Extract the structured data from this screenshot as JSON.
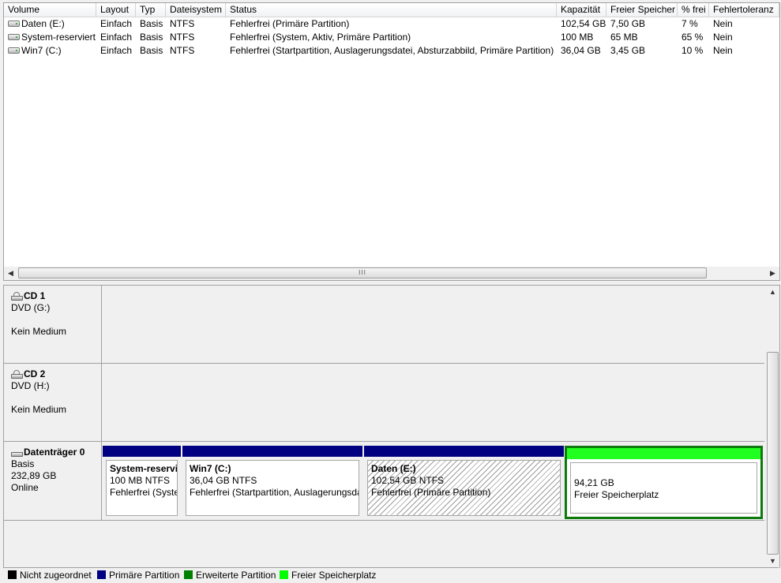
{
  "volume_list": {
    "columns": [
      "Volume",
      "Layout",
      "Typ",
      "Dateisystem",
      "Status",
      "Kapazität",
      "Freier Speicher",
      "% frei",
      "Fehlertoleranz"
    ],
    "rows": [
      [
        "Daten (E:)",
        "Einfach",
        "Basis",
        "NTFS",
        "Fehlerfrei (Primäre Partition)",
        "102,54 GB",
        "7,50 GB",
        "7 %",
        "Nein"
      ],
      [
        "System-reserviert",
        "Einfach",
        "Basis",
        "NTFS",
        "Fehlerfrei (System, Aktiv, Primäre Partition)",
        "100 MB",
        "65 MB",
        "65 %",
        "Nein"
      ],
      [
        "Win7 (C:)",
        "Einfach",
        "Basis",
        "NTFS",
        "Fehlerfrei (Startpartition, Auslagerungsdatei, Absturzabbild, Primäre Partition)",
        "36,04 GB",
        "3,45 GB",
        "10 %",
        "Nein"
      ]
    ],
    "scroll_thumb_label": "III",
    "icons": {
      "scroll_left": "chevron-left-icon",
      "scroll_right": "chevron-right-icon",
      "volume": "volume-drive-icon"
    }
  },
  "disks": [
    {
      "id": "cd1",
      "icon": "cd-drive-icon",
      "title": "CD 1",
      "line1": "DVD (G:)",
      "line2": "",
      "line3": "Kein Medium"
    },
    {
      "id": "cd2",
      "icon": "cd-drive-icon",
      "title": "CD 2",
      "line1": "DVD (H:)",
      "line2": "",
      "line3": "Kein Medium"
    },
    {
      "id": "disk0",
      "icon": "hard-disk-icon",
      "title": "Datenträger 0",
      "line1": "Basis",
      "line2": "232,89 GB",
      "line3": "Online",
      "partitions": [
        {
          "name": "System-reservi",
          "line1": "100 MB NTFS",
          "line2": "Fehlerfrei (Syste",
          "kind": "primary"
        },
        {
          "name": "Win7  (C:)",
          "line1": "36,04 GB NTFS",
          "line2": "Fehlerfrei (Startpartition, Auslagerungsda",
          "kind": "primary"
        },
        {
          "name": "Daten  (E:)",
          "line1": "102,54 GB NTFS",
          "line2": "Fehlerfrei (Primäre Partition)",
          "kind": "primary",
          "selected": true
        },
        {
          "name": "",
          "line1": "94,21 GB",
          "line2": "Freier Speicherplatz",
          "kind": "free"
        }
      ]
    }
  ],
  "legend": [
    {
      "label": "Nicht zugeordnet",
      "color": "#000000"
    },
    {
      "label": "Primäre Partition",
      "color": "#000080"
    },
    {
      "label": "Erweiterte Partition",
      "color": "#008000"
    },
    {
      "label": "Freier Speicherplatz",
      "color": "#00ff00"
    }
  ],
  "colors": {
    "primary": "#000080",
    "free": "#20ff20",
    "free_border": "#0e7a0e"
  }
}
